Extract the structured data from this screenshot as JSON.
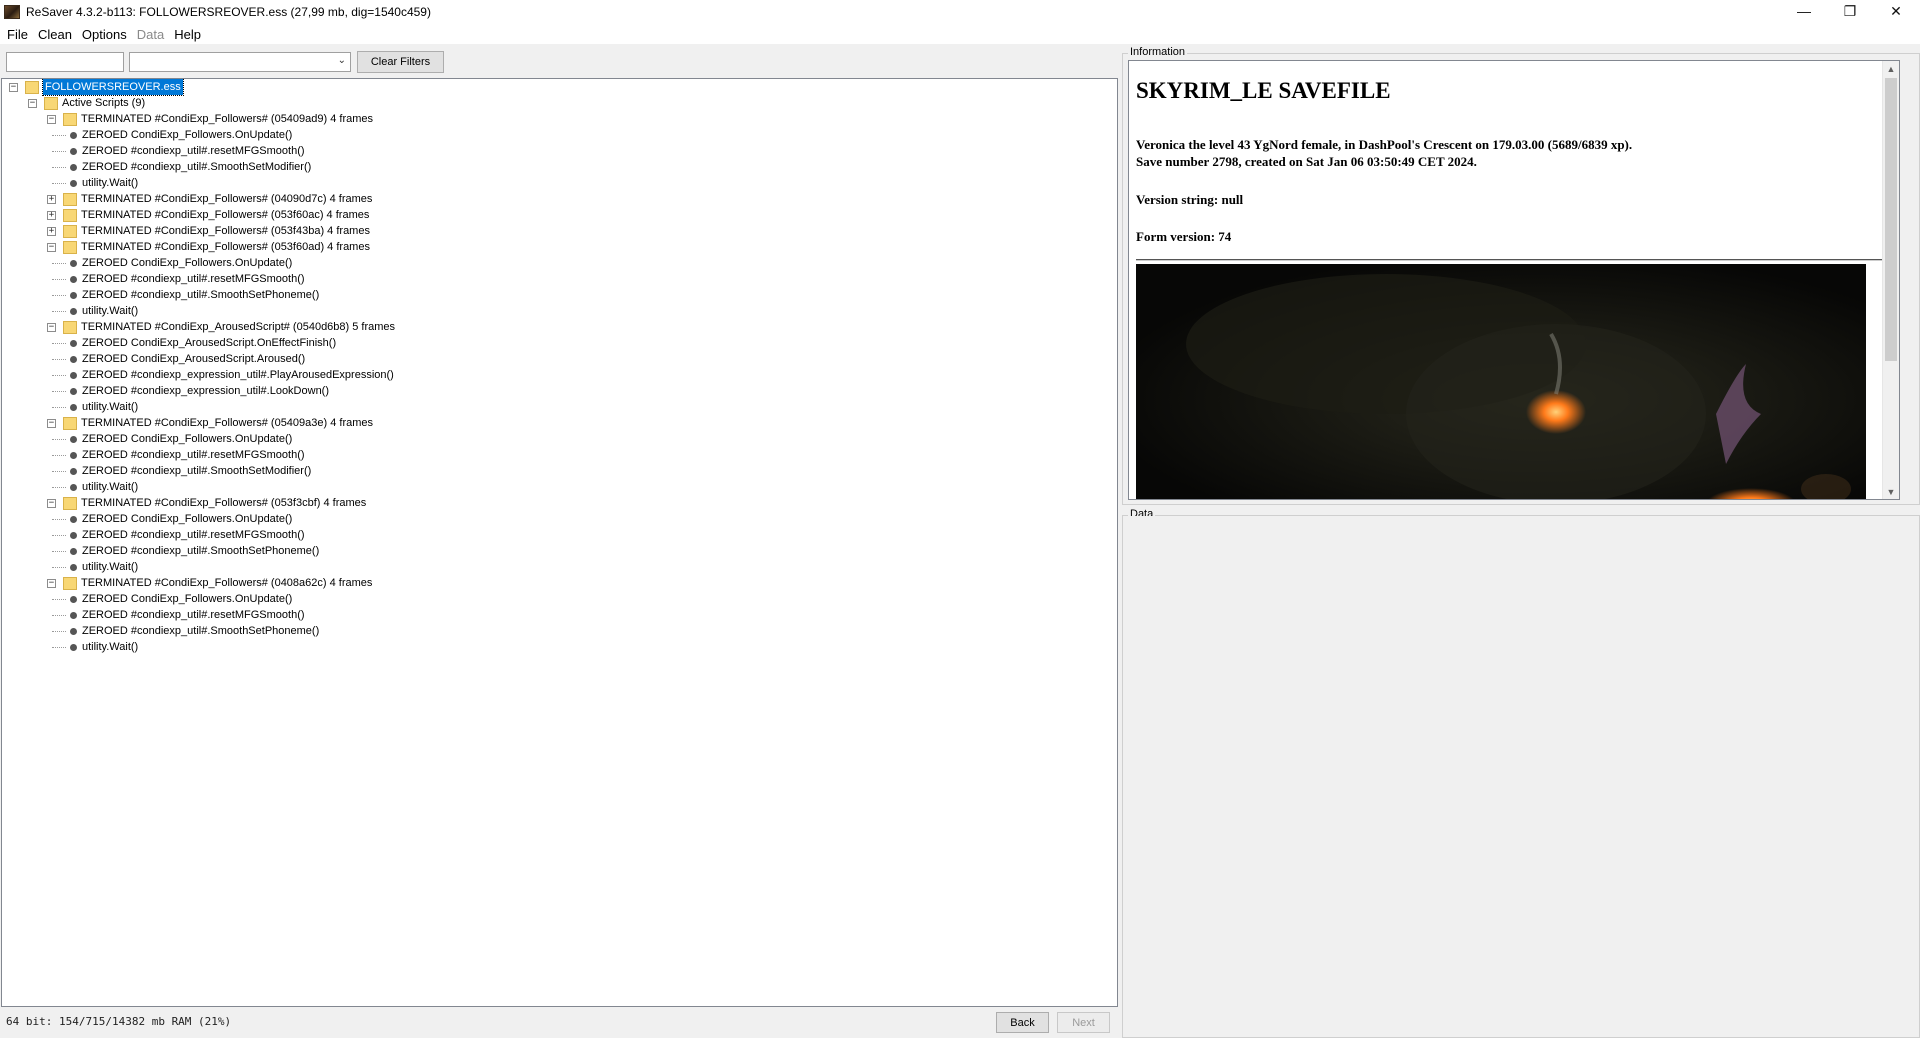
{
  "window": {
    "title": "ReSaver 4.3.2-b113: FOLLOWERSREOVER.ess (27,99 mb, dig=1540c459)",
    "controls": {
      "minimize": "—",
      "maximize": "❐",
      "close": "✕"
    }
  },
  "menu": {
    "items": [
      {
        "label": "File",
        "enabled": true
      },
      {
        "label": "Clean",
        "enabled": true
      },
      {
        "label": "Options",
        "enabled": true
      },
      {
        "label": "Data",
        "enabled": false
      },
      {
        "label": "Help",
        "enabled": true
      }
    ]
  },
  "filters": {
    "text_value": "",
    "combo_value": "",
    "clear_label": "Clear Filters"
  },
  "tree": {
    "rows": [
      {
        "text": "FOLLOWERSREOVER.ess",
        "depth": 0,
        "kind": "folder",
        "expander": "−",
        "selected": true
      },
      {
        "text": "Active Scripts (9)",
        "depth": 1,
        "kind": "folder",
        "expander": "−"
      },
      {
        "text": "TERMINATED #CondiExp_Followers# (05409ad9) 4 frames",
        "depth": 2,
        "kind": "folder",
        "expander": "−"
      },
      {
        "text": "ZEROED CondiExp_Followers.OnUpdate()",
        "depth": 3,
        "kind": "leaf"
      },
      {
        "text": "ZEROED #condiexp_util#.resetMFGSmooth()",
        "depth": 3,
        "kind": "leaf"
      },
      {
        "text": "ZEROED #condiexp_util#.SmoothSetModifier()",
        "depth": 3,
        "kind": "leaf"
      },
      {
        "text": "utility.Wait()",
        "depth": 3,
        "kind": "leaf"
      },
      {
        "text": "TERMINATED #CondiExp_Followers# (04090d7c) 4 frames",
        "depth": 2,
        "kind": "folder",
        "expander": "+"
      },
      {
        "text": "TERMINATED #CondiExp_Followers# (053f60ac) 4 frames",
        "depth": 2,
        "kind": "folder",
        "expander": "+"
      },
      {
        "text": "TERMINATED #CondiExp_Followers# (053f43ba) 4 frames",
        "depth": 2,
        "kind": "folder",
        "expander": "+"
      },
      {
        "text": "TERMINATED #CondiExp_Followers# (053f60ad) 4 frames",
        "depth": 2,
        "kind": "folder",
        "expander": "−"
      },
      {
        "text": "ZEROED CondiExp_Followers.OnUpdate()",
        "depth": 3,
        "kind": "leaf"
      },
      {
        "text": "ZEROED #condiexp_util#.resetMFGSmooth()",
        "depth": 3,
        "kind": "leaf"
      },
      {
        "text": "ZEROED #condiexp_util#.SmoothSetPhoneme()",
        "depth": 3,
        "kind": "leaf"
      },
      {
        "text": "utility.Wait()",
        "depth": 3,
        "kind": "leaf"
      },
      {
        "text": "TERMINATED #CondiExp_ArousedScript# (0540d6b8) 5 frames",
        "depth": 2,
        "kind": "folder",
        "expander": "−"
      },
      {
        "text": "ZEROED CondiExp_ArousedScript.OnEffectFinish()",
        "depth": 3,
        "kind": "leaf"
      },
      {
        "text": "ZEROED CondiExp_ArousedScript.Aroused()",
        "depth": 3,
        "kind": "leaf"
      },
      {
        "text": "ZEROED #condiexp_expression_util#.PlayArousedExpression()",
        "depth": 3,
        "kind": "leaf"
      },
      {
        "text": "ZEROED #condiexp_expression_util#.LookDown()",
        "depth": 3,
        "kind": "leaf"
      },
      {
        "text": "utility.Wait()",
        "depth": 3,
        "kind": "leaf"
      },
      {
        "text": "TERMINATED #CondiExp_Followers# (05409a3e) 4 frames",
        "depth": 2,
        "kind": "folder",
        "expander": "−"
      },
      {
        "text": "ZEROED CondiExp_Followers.OnUpdate()",
        "depth": 3,
        "kind": "leaf"
      },
      {
        "text": "ZEROED #condiexp_util#.resetMFGSmooth()",
        "depth": 3,
        "kind": "leaf"
      },
      {
        "text": "ZEROED #condiexp_util#.SmoothSetModifier()",
        "depth": 3,
        "kind": "leaf"
      },
      {
        "text": "utility.Wait()",
        "depth": 3,
        "kind": "leaf"
      },
      {
        "text": "TERMINATED #CondiExp_Followers# (053f3cbf) 4 frames",
        "depth": 2,
        "kind": "folder",
        "expander": "−"
      },
      {
        "text": "ZEROED CondiExp_Followers.OnUpdate()",
        "depth": 3,
        "kind": "leaf"
      },
      {
        "text": "ZEROED #condiexp_util#.resetMFGSmooth()",
        "depth": 3,
        "kind": "leaf"
      },
      {
        "text": "ZEROED #condiexp_util#.SmoothSetPhoneme()",
        "depth": 3,
        "kind": "leaf"
      },
      {
        "text": "utility.Wait()",
        "depth": 3,
        "kind": "leaf"
      },
      {
        "text": "TERMINATED #CondiExp_Followers# (0408a62c) 4 frames",
        "depth": 2,
        "kind": "folder",
        "expander": "−"
      },
      {
        "text": "ZEROED CondiExp_Followers.OnUpdate()",
        "depth": 3,
        "kind": "leaf"
      },
      {
        "text": "ZEROED #condiexp_util#.resetMFGSmooth()",
        "depth": 3,
        "kind": "leaf"
      },
      {
        "text": "ZEROED #condiexp_util#.SmoothSetPhoneme()",
        "depth": 3,
        "kind": "leaf"
      },
      {
        "text": "utility.Wait()",
        "depth": 3,
        "kind": "leaf"
      }
    ]
  },
  "status": {
    "memory": "64 bit: 154/715/14382 mb RAM (21%)",
    "back_label": "Back",
    "next_label": "Next"
  },
  "information": {
    "group_title": "Information",
    "heading": "SKYRIM_LE SAVEFILE",
    "description": "Veronica the level 43 YgNord female, in DashPool's Crescent on 179.03.00 (5689/6839 xp).",
    "save_line": "Save number 2798, created on Sat Jan 06 03:50:49 CET 2024.",
    "version_string": "Version string: null",
    "form_version": "Form version: 74"
  },
  "data_panel": {
    "group_title": "Data"
  }
}
